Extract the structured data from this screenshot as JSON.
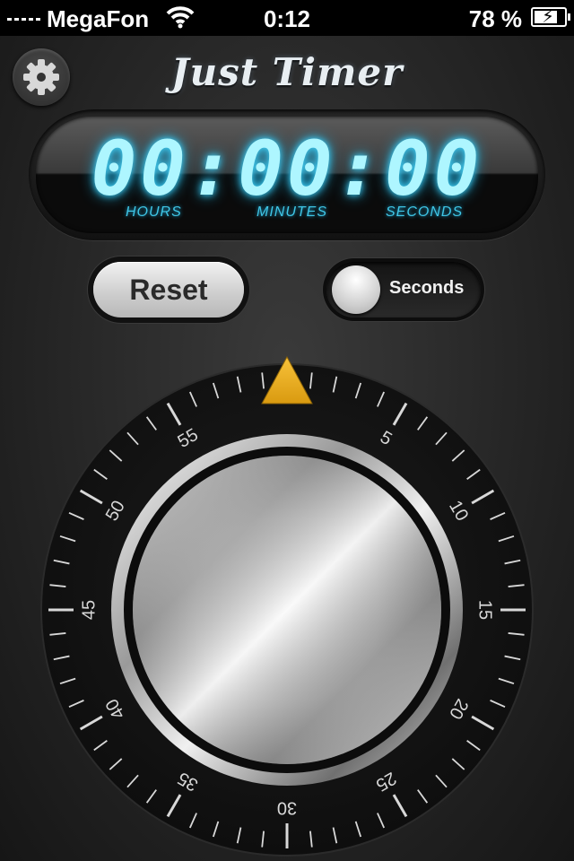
{
  "status_bar": {
    "carrier": "MegaFon",
    "time": "0:12",
    "battery_percent": "78 %",
    "battery_level": 0.78
  },
  "app": {
    "title": "Just Timer",
    "display": {
      "value": "00:00:00",
      "labels": {
        "hours": "HOURS",
        "minutes": "MINUTES",
        "seconds": "SECONDS"
      }
    },
    "reset_label": "Reset",
    "mode_toggle": {
      "label": "Seconds"
    },
    "dial": {
      "numbers": [
        "5",
        "10",
        "15",
        "20",
        "25",
        "30",
        "35",
        "40",
        "45",
        "50",
        "55"
      ],
      "pointer_color": "#f2b01e"
    }
  },
  "colors": {
    "digit_glow": "#41d8ff",
    "label_cyan": "#3fc6e6"
  },
  "icons": [
    "gear-icon",
    "wifi-icon",
    "battery-icon",
    "signal-icon",
    "pointer-triangle-icon"
  ]
}
